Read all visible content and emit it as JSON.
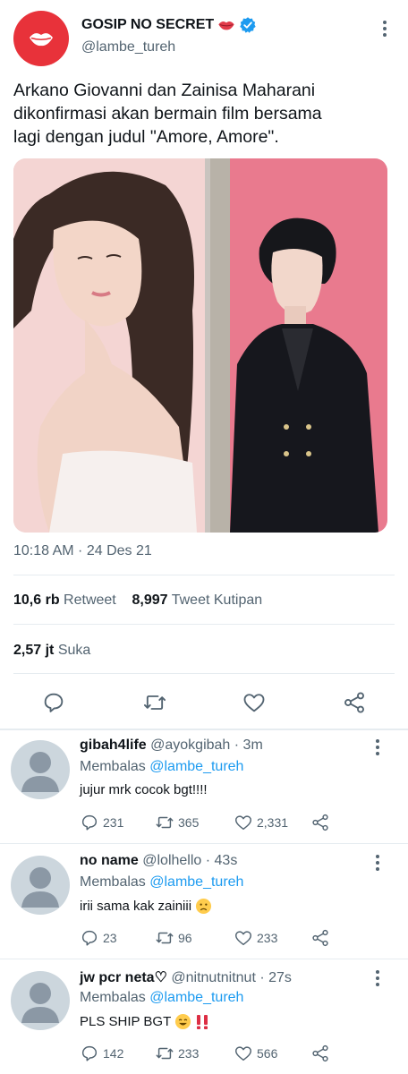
{
  "tweet": {
    "author_name": "GOSIP NO SECRET",
    "author_handle": "@lambe_tureh",
    "text": "Arkano Giovanni dan Zainisa Maharani\ndikonfirmasi akan bermain film bersama\nlagi dengan judul \"Amore, Amore\".",
    "timestamp": "10:18 AM · 24 Des 21",
    "retweets_count": "10,6 rb",
    "retweets_label": "Retweet",
    "quotes_count": "8,997",
    "quotes_label": "Tweet Kutipan",
    "likes_count": "2,57 jt",
    "likes_label": "Suka"
  },
  "replies": [
    {
      "name": "gibah4life",
      "handle": "@ayokgibah · 3m",
      "replying_prefix": "Membalas ",
      "replying_to": "@lambe_tureh",
      "text": "jujur mrk cocok bgt!!!!",
      "reply_count": "231",
      "retweet_count": "365",
      "like_count": "2,331"
    },
    {
      "name": "no name",
      "handle": "@lolhello · 43s",
      "replying_prefix": "Membalas ",
      "replying_to": "@lambe_tureh",
      "text": "irii sama kak zainiii",
      "reply_count": "23",
      "retweet_count": "96",
      "like_count": "233"
    },
    {
      "name": "jw pcr neta♡",
      "handle": "@nitnutnitnut · 27s",
      "replying_prefix": "Membalas ",
      "replying_to": "@lambe_tureh",
      "text": "PLS SHIP BGT",
      "reply_count": "142",
      "retweet_count": "233",
      "like_count": "566"
    }
  ],
  "colors": {
    "brand_red": "#e8323a",
    "verified_blue": "#1d9bf0",
    "muted_text": "#536471",
    "mention_blue": "#1d9bf0"
  },
  "icons": [
    "lips-icon",
    "verified-badge-icon",
    "more-icon",
    "reply-icon",
    "retweet-icon",
    "like-icon",
    "share-icon",
    "default-avatar-icon",
    "emoji-icon"
  ]
}
